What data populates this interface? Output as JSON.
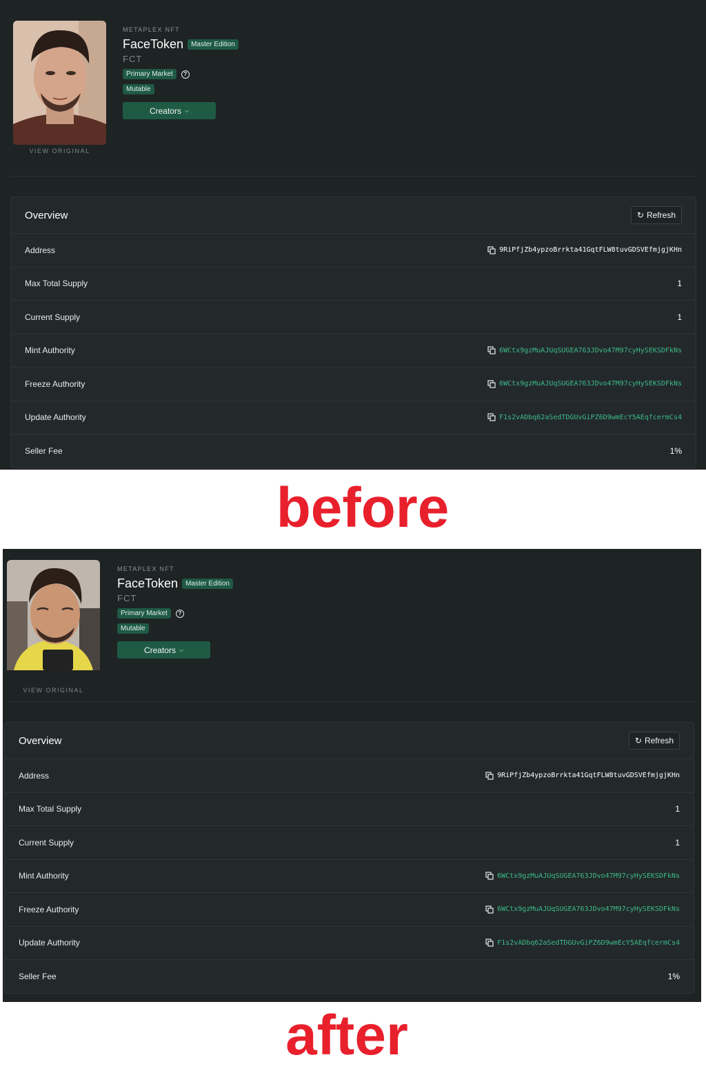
{
  "panels": [
    {
      "kicker": "METAPLEX NFT",
      "title": "FaceToken",
      "edition_badge": "Master Edition",
      "symbol": "FCT",
      "market_badge": "Primary Market",
      "mutable_badge": "Mutable",
      "creators_label": "Creators",
      "view_original": "VIEW ORIGINAL",
      "overview_title": "Overview",
      "refresh_label": "Refresh",
      "rows": [
        {
          "label": "Address",
          "value": "9RiPfjZb4ypzoBrrkta41GqtFLW8tuvGDSVEfmjgjKHn"
        },
        {
          "label": "Max Total Supply",
          "value": "1"
        },
        {
          "label": "Current Supply",
          "value": "1"
        },
        {
          "label": "Mint Authority",
          "value": "6WCtx9gzMuAJUqSUGEA763JDvo47M97cyHySEKSDFkNs"
        },
        {
          "label": "Freeze Authority",
          "value": "6WCtx9gzMuAJUqSUGEA763JDvo47M97cyHySEKSDFkNs"
        },
        {
          "label": "Update Authority",
          "value": "F1s2vADbq62aSedTDGUvGiPZ6D9wmEcY5AEqfcermCs4"
        },
        {
          "label": "Seller Fee",
          "value": "1%"
        }
      ]
    },
    {
      "kicker": "METAPLEX NFT",
      "title": "FaceToken",
      "edition_badge": "Master Edition",
      "symbol": "FCT",
      "market_badge": "Primary Market",
      "mutable_badge": "Mutable",
      "creators_label": "Creators",
      "view_original": "VIEW ORIGINAL",
      "overview_title": "Overview",
      "refresh_label": "Refresh",
      "rows": [
        {
          "label": "Address",
          "value": "9RiPfjZb4ypzoBrrkta41GqtFLW8tuvGDSVEfmjgjKHn"
        },
        {
          "label": "Max Total Supply",
          "value": "1"
        },
        {
          "label": "Current Supply",
          "value": "1"
        },
        {
          "label": "Mint Authority",
          "value": "6WCtx9gzMuAJUqSUGEA763JDvo47M97cyHySEKSDFkNs"
        },
        {
          "label": "Freeze Authority",
          "value": "6WCtx9gzMuAJUqSUGEA763JDvo47M97cyHySEKSDFkNs"
        },
        {
          "label": "Update Authority",
          "value": "F1s2vADbq62aSedTDGUvGiPZ6D9wmEcY5AEqfcermCs4"
        },
        {
          "label": "Seller Fee",
          "value": "1%"
        }
      ]
    }
  ],
  "captions": {
    "before": "before",
    "after": "after"
  },
  "colors": {
    "accent_green": "#3dbb8a",
    "badge_green": "#1f5a45",
    "caption_red": "#e8202c"
  },
  "icons": {
    "copy": "copy-icon",
    "refresh": "refresh-icon",
    "help": "help-icon",
    "chevron": "chevron-down-icon"
  }
}
